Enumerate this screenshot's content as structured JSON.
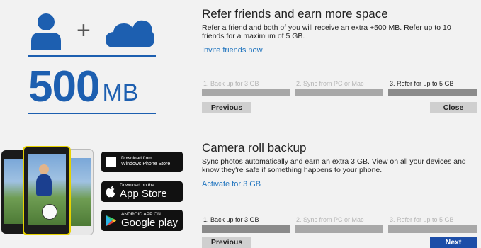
{
  "promo": {
    "size_number": "500",
    "size_unit": "MB",
    "plus_sign": "+",
    "icons": [
      "person-icon",
      "cloud-icon"
    ],
    "accent_color": "#1d5fb0",
    "stores": [
      {
        "small": "Download from",
        "large": "Windows Phone Store",
        "icon": "windows-logo-icon"
      },
      {
        "small": "Download on the",
        "large": "App Store",
        "icon": "apple-logo-icon"
      },
      {
        "small": "ANDROID APP ON",
        "large": "Google play",
        "icon": "google-play-icon"
      }
    ]
  },
  "refer": {
    "title": "Refer friends and earn more space",
    "description": "Refer a friend and both of you will receive an extra +500 MB. Refer up to 10 friends for a maximum of 5 GB.",
    "link": "Invite friends now",
    "steps": [
      {
        "label": "1. Back up for 3 GB",
        "active": false
      },
      {
        "label": "2. Sync from PC or Mac",
        "active": false
      },
      {
        "label": "3. Refer for up to 5 GB",
        "active": true
      }
    ],
    "prev_label": "Previous",
    "next_label": "Close"
  },
  "camera": {
    "title": "Camera roll backup",
    "description": "Sync photos automatically and earn an extra 3 GB. View on all your devices and know they're safe if something happens to your phone.",
    "link": "Activate for 3 GB",
    "steps": [
      {
        "label": "1. Back up for 3 GB",
        "active": true
      },
      {
        "label": "2. Sync from PC or Mac",
        "active": false
      },
      {
        "label": "3. Refer for up to 5 GB",
        "active": false
      }
    ],
    "prev_label": "Previous",
    "next_label": "Next"
  },
  "colors": {
    "link": "#1e73be",
    "primary_button": "#1d4ea8",
    "bar_active": "#8b8b8b",
    "bar_inactive": "#a8a8a8"
  }
}
